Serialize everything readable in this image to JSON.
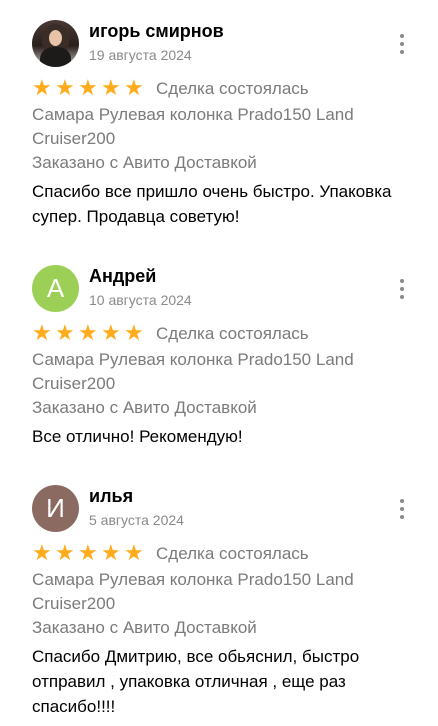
{
  "reviews": [
    {
      "author": "игорь смирнов",
      "date": "19 августа 2024",
      "avatar": {
        "type": "photo",
        "letter": "",
        "color": "#3a2c26"
      },
      "rating": 5,
      "deal_status": "Сделка состоялась",
      "item": "Самара Рулевая колонка Prado150 Land Cruiser200",
      "delivery": "Заказано с Авито Доставкой",
      "text": "Спасибо все пришло очень быстро. Упаковка супер. Продавца советую!"
    },
    {
      "author": "Андрей",
      "date": "10 августа 2024",
      "avatar": {
        "type": "letter",
        "letter": "А",
        "color": "#9ccf55"
      },
      "rating": 5,
      "deal_status": "Сделка состоялась",
      "item": "Самара Рулевая колонка Prado150 Land Cruiser200",
      "delivery": "Заказано с Авито Доставкой",
      "text": "Все отлично! Рекомендую!"
    },
    {
      "author": "илья",
      "date": "5 августа 2024",
      "avatar": {
        "type": "letter",
        "letter": "И",
        "color": "#8b6a62"
      },
      "rating": 5,
      "deal_status": "Сделка состоялась",
      "item": "Самара Рулевая колонка Prado150 Land Cruiser200",
      "delivery": "Заказано с Авито Доставкой",
      "text": "Спасибо Дмитрию, все обьяснил, быстро отправил , упаковка отличная , еще раз спасибо!!!!"
    }
  ],
  "icons": {
    "star": "star-icon",
    "more": "more-vertical-icon"
  },
  "colors": {
    "star": "#ffac1c",
    "secondary_text": "#7b7b7b",
    "date_text": "#8a8a8a"
  }
}
